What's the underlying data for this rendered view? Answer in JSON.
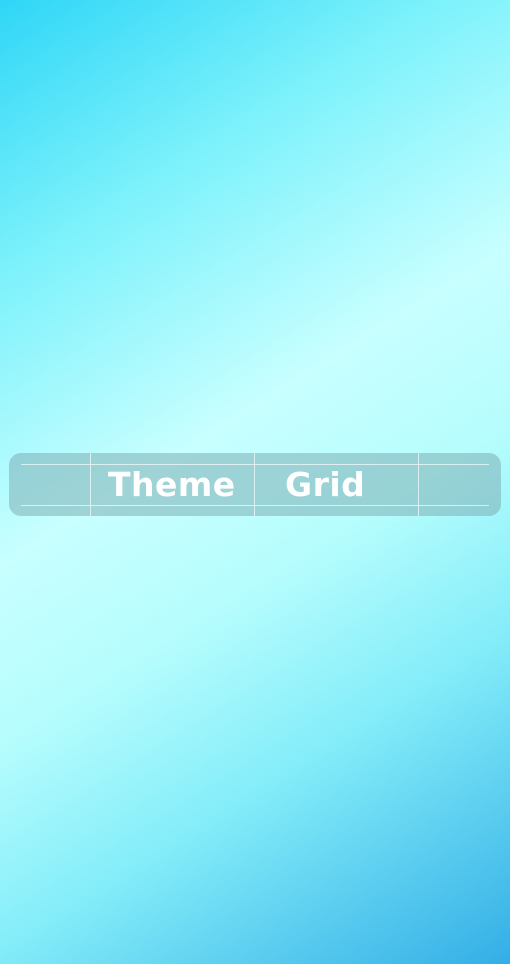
{
  "title_bar": {
    "left_word": "Theme",
    "right_word": "Grid"
  }
}
